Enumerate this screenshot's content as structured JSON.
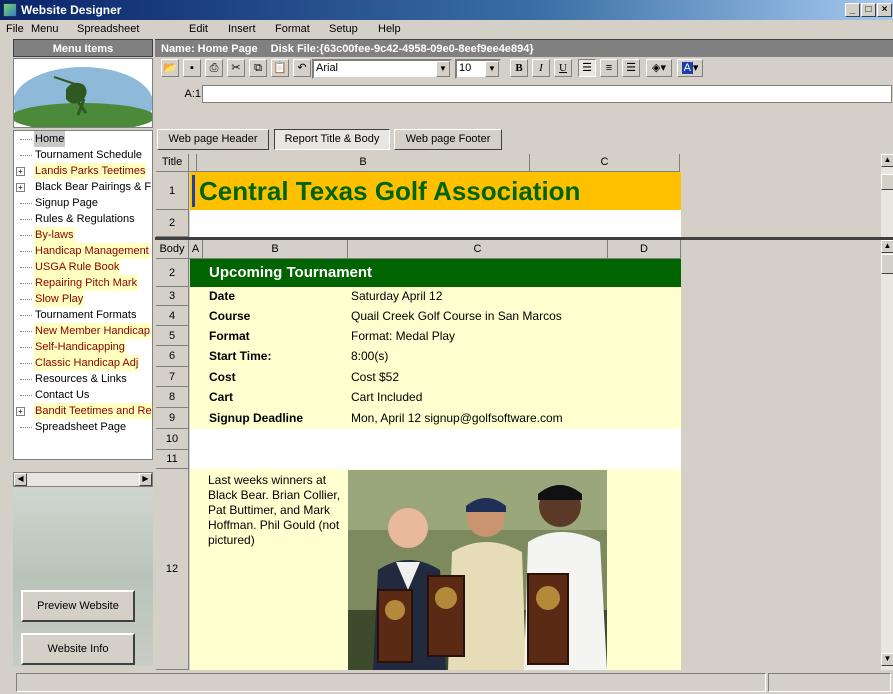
{
  "window": {
    "title": "Website Designer",
    "min": "_",
    "max": "□",
    "close": "×"
  },
  "menu": [
    "File",
    "Menu",
    "Spreadsheet",
    "Edit",
    "Insert",
    "Format",
    "Setup",
    "Help"
  ],
  "panel": {
    "heading": "Menu Items"
  },
  "info": {
    "name": "Name: Home Page",
    "disk": "Disk File:{63c00fee-9c42-4958-09e0-8eef9ee4e894}"
  },
  "toolbar": {
    "font": "Arial",
    "size": "10",
    "bold": "B",
    "italic": "I",
    "underline": "U",
    "cellref": "A:1"
  },
  "tree": [
    {
      "label": "Home",
      "style": "sel",
      "plus": false
    },
    {
      "label": "Tournament Schedule",
      "style": "",
      "plus": false
    },
    {
      "label": "Landis Parks Teetimes",
      "style": "y",
      "plus": true
    },
    {
      "label": "Black Bear Pairings & F",
      "style": "",
      "plus": true
    },
    {
      "label": "Signup Page",
      "style": "",
      "plus": false
    },
    {
      "label": "Rules & Regulations",
      "style": "",
      "plus": false
    },
    {
      "label": "By-laws",
      "style": "y",
      "plus": false
    },
    {
      "label": "Handicap Management",
      "style": "y",
      "plus": false
    },
    {
      "label": "USGA Rule Book",
      "style": "y",
      "plus": false
    },
    {
      "label": "Repairing Pitch Mark",
      "style": "y",
      "plus": false
    },
    {
      "label": "Slow Play",
      "style": "y",
      "plus": false
    },
    {
      "label": "Tournament Formats",
      "style": "",
      "plus": false
    },
    {
      "label": "New Member Handicap",
      "style": "y",
      "plus": false
    },
    {
      "label": "Self-Handicapping",
      "style": "y",
      "plus": false
    },
    {
      "label": "Classic Handicap Adj",
      "style": "y",
      "plus": false
    },
    {
      "label": "Resources & Links",
      "style": "",
      "plus": false
    },
    {
      "label": "Contact Us",
      "style": "",
      "plus": false
    },
    {
      "label": "Bandit Teetimes and Re",
      "style": "y",
      "plus": true
    },
    {
      "label": "Spreadsheet Page",
      "style": "",
      "plus": false
    }
  ],
  "buttons": {
    "preview": "Preview Website",
    "info": "Website Info"
  },
  "tabs": [
    "Web page Header",
    "Report Title & Body",
    "Web page Footer"
  ],
  "title_grid": {
    "corner": "Title",
    "colB": "B",
    "colC": "C",
    "rows": [
      "1",
      "2"
    ],
    "text": "Central Texas Golf Association"
  },
  "body_grid": {
    "corner": "Body",
    "colA": "A",
    "colB": "B",
    "colC": "C",
    "colD": "D",
    "heading": "Upcoming Tournament",
    "rows": [
      {
        "n": "2"
      },
      {
        "n": "3",
        "label": "Date",
        "value": "Saturday April 12"
      },
      {
        "n": "4",
        "label": "Course",
        "value": "Quail Creek Golf Course in San Marcos"
      },
      {
        "n": "5",
        "label": "Format",
        "value": "Format: Medal Play"
      },
      {
        "n": "6",
        "label": "Start Time:",
        "value": "8:00(s)"
      },
      {
        "n": "7",
        "label": "Cost",
        "value": "Cost $52"
      },
      {
        "n": "8",
        "label": "Cart",
        "value": "Cart Included"
      },
      {
        "n": "9",
        "label": "Signup Deadline",
        "value": "Mon, April 12 signup@golfsoftware.com"
      },
      {
        "n": "10"
      },
      {
        "n": "11"
      },
      {
        "n": "12"
      }
    ],
    "winners": "Last weeks winners at Black Bear. Brian Collier, Pat Buttimer, and Mark Hoffman. Phil Gould (not pictured)"
  },
  "colors": {
    "title_bg": "#ffc000",
    "title_fg": "#006400",
    "heading_bg": "#006400",
    "body_bg": "#ffffd0"
  }
}
